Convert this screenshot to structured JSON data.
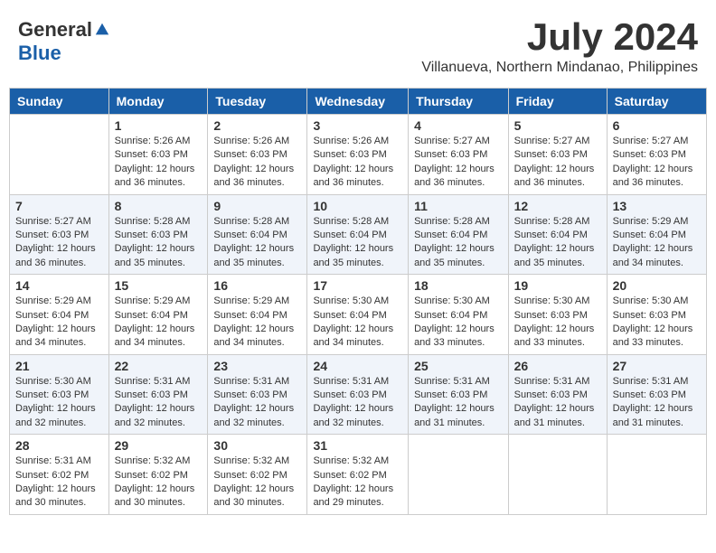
{
  "header": {
    "logo_general": "General",
    "logo_blue": "Blue",
    "month_year": "July 2024",
    "location": "Villanueva, Northern Mindanao, Philippines"
  },
  "days_of_week": [
    "Sunday",
    "Monday",
    "Tuesday",
    "Wednesday",
    "Thursday",
    "Friday",
    "Saturday"
  ],
  "weeks": [
    [
      {
        "day": "",
        "sunrise": "",
        "sunset": "",
        "daylight": ""
      },
      {
        "day": "1",
        "sunrise": "Sunrise: 5:26 AM",
        "sunset": "Sunset: 6:03 PM",
        "daylight": "Daylight: 12 hours and 36 minutes."
      },
      {
        "day": "2",
        "sunrise": "Sunrise: 5:26 AM",
        "sunset": "Sunset: 6:03 PM",
        "daylight": "Daylight: 12 hours and 36 minutes."
      },
      {
        "day": "3",
        "sunrise": "Sunrise: 5:26 AM",
        "sunset": "Sunset: 6:03 PM",
        "daylight": "Daylight: 12 hours and 36 minutes."
      },
      {
        "day": "4",
        "sunrise": "Sunrise: 5:27 AM",
        "sunset": "Sunset: 6:03 PM",
        "daylight": "Daylight: 12 hours and 36 minutes."
      },
      {
        "day": "5",
        "sunrise": "Sunrise: 5:27 AM",
        "sunset": "Sunset: 6:03 PM",
        "daylight": "Daylight: 12 hours and 36 minutes."
      },
      {
        "day": "6",
        "sunrise": "Sunrise: 5:27 AM",
        "sunset": "Sunset: 6:03 PM",
        "daylight": "Daylight: 12 hours and 36 minutes."
      }
    ],
    [
      {
        "day": "7",
        "sunrise": "Sunrise: 5:27 AM",
        "sunset": "Sunset: 6:03 PM",
        "daylight": "Daylight: 12 hours and 36 minutes."
      },
      {
        "day": "8",
        "sunrise": "Sunrise: 5:28 AM",
        "sunset": "Sunset: 6:03 PM",
        "daylight": "Daylight: 12 hours and 35 minutes."
      },
      {
        "day": "9",
        "sunrise": "Sunrise: 5:28 AM",
        "sunset": "Sunset: 6:04 PM",
        "daylight": "Daylight: 12 hours and 35 minutes."
      },
      {
        "day": "10",
        "sunrise": "Sunrise: 5:28 AM",
        "sunset": "Sunset: 6:04 PM",
        "daylight": "Daylight: 12 hours and 35 minutes."
      },
      {
        "day": "11",
        "sunrise": "Sunrise: 5:28 AM",
        "sunset": "Sunset: 6:04 PM",
        "daylight": "Daylight: 12 hours and 35 minutes."
      },
      {
        "day": "12",
        "sunrise": "Sunrise: 5:28 AM",
        "sunset": "Sunset: 6:04 PM",
        "daylight": "Daylight: 12 hours and 35 minutes."
      },
      {
        "day": "13",
        "sunrise": "Sunrise: 5:29 AM",
        "sunset": "Sunset: 6:04 PM",
        "daylight": "Daylight: 12 hours and 34 minutes."
      }
    ],
    [
      {
        "day": "14",
        "sunrise": "Sunrise: 5:29 AM",
        "sunset": "Sunset: 6:04 PM",
        "daylight": "Daylight: 12 hours and 34 minutes."
      },
      {
        "day": "15",
        "sunrise": "Sunrise: 5:29 AM",
        "sunset": "Sunset: 6:04 PM",
        "daylight": "Daylight: 12 hours and 34 minutes."
      },
      {
        "day": "16",
        "sunrise": "Sunrise: 5:29 AM",
        "sunset": "Sunset: 6:04 PM",
        "daylight": "Daylight: 12 hours and 34 minutes."
      },
      {
        "day": "17",
        "sunrise": "Sunrise: 5:30 AM",
        "sunset": "Sunset: 6:04 PM",
        "daylight": "Daylight: 12 hours and 34 minutes."
      },
      {
        "day": "18",
        "sunrise": "Sunrise: 5:30 AM",
        "sunset": "Sunset: 6:04 PM",
        "daylight": "Daylight: 12 hours and 33 minutes."
      },
      {
        "day": "19",
        "sunrise": "Sunrise: 5:30 AM",
        "sunset": "Sunset: 6:03 PM",
        "daylight": "Daylight: 12 hours and 33 minutes."
      },
      {
        "day": "20",
        "sunrise": "Sunrise: 5:30 AM",
        "sunset": "Sunset: 6:03 PM",
        "daylight": "Daylight: 12 hours and 33 minutes."
      }
    ],
    [
      {
        "day": "21",
        "sunrise": "Sunrise: 5:30 AM",
        "sunset": "Sunset: 6:03 PM",
        "daylight": "Daylight: 12 hours and 32 minutes."
      },
      {
        "day": "22",
        "sunrise": "Sunrise: 5:31 AM",
        "sunset": "Sunset: 6:03 PM",
        "daylight": "Daylight: 12 hours and 32 minutes."
      },
      {
        "day": "23",
        "sunrise": "Sunrise: 5:31 AM",
        "sunset": "Sunset: 6:03 PM",
        "daylight": "Daylight: 12 hours and 32 minutes."
      },
      {
        "day": "24",
        "sunrise": "Sunrise: 5:31 AM",
        "sunset": "Sunset: 6:03 PM",
        "daylight": "Daylight: 12 hours and 32 minutes."
      },
      {
        "day": "25",
        "sunrise": "Sunrise: 5:31 AM",
        "sunset": "Sunset: 6:03 PM",
        "daylight": "Daylight: 12 hours and 31 minutes."
      },
      {
        "day": "26",
        "sunrise": "Sunrise: 5:31 AM",
        "sunset": "Sunset: 6:03 PM",
        "daylight": "Daylight: 12 hours and 31 minutes."
      },
      {
        "day": "27",
        "sunrise": "Sunrise: 5:31 AM",
        "sunset": "Sunset: 6:03 PM",
        "daylight": "Daylight: 12 hours and 31 minutes."
      }
    ],
    [
      {
        "day": "28",
        "sunrise": "Sunrise: 5:31 AM",
        "sunset": "Sunset: 6:02 PM",
        "daylight": "Daylight: 12 hours and 30 minutes."
      },
      {
        "day": "29",
        "sunrise": "Sunrise: 5:32 AM",
        "sunset": "Sunset: 6:02 PM",
        "daylight": "Daylight: 12 hours and 30 minutes."
      },
      {
        "day": "30",
        "sunrise": "Sunrise: 5:32 AM",
        "sunset": "Sunset: 6:02 PM",
        "daylight": "Daylight: 12 hours and 30 minutes."
      },
      {
        "day": "31",
        "sunrise": "Sunrise: 5:32 AM",
        "sunset": "Sunset: 6:02 PM",
        "daylight": "Daylight: 12 hours and 29 minutes."
      },
      {
        "day": "",
        "sunrise": "",
        "sunset": "",
        "daylight": ""
      },
      {
        "day": "",
        "sunrise": "",
        "sunset": "",
        "daylight": ""
      },
      {
        "day": "",
        "sunrise": "",
        "sunset": "",
        "daylight": ""
      }
    ]
  ]
}
